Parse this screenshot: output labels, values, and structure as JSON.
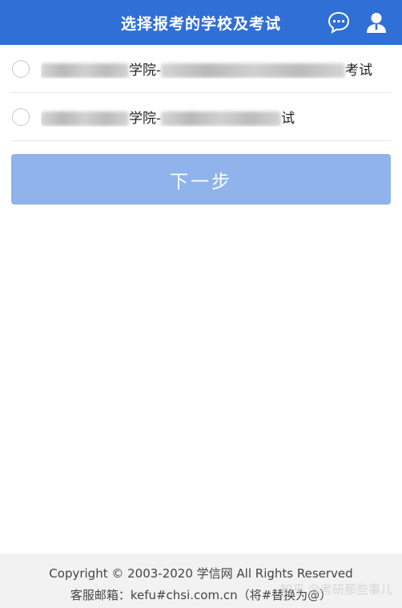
{
  "header": {
    "title": "选择报考的学校及考试",
    "icons": [
      "chat-bubble-icon",
      "user-icon"
    ],
    "color": "#2f6fd6"
  },
  "options": [
    {
      "text_visible_1": "学院-",
      "text_visible_2": "考试",
      "blurred": true
    },
    {
      "text_visible_1": "学院-",
      "text_visible_2": "试",
      "blurred": true
    }
  ],
  "next_button": {
    "label": "下一步",
    "color": "#8fb3ea"
  },
  "footer": {
    "copyright": "Copyright © 2003-2020 学信网 All Rights Reserved",
    "email": "客服邮箱：kefu#chsi.com.cn（将#替换为@）"
  },
  "watermark": "知乎 @考研那些事儿"
}
